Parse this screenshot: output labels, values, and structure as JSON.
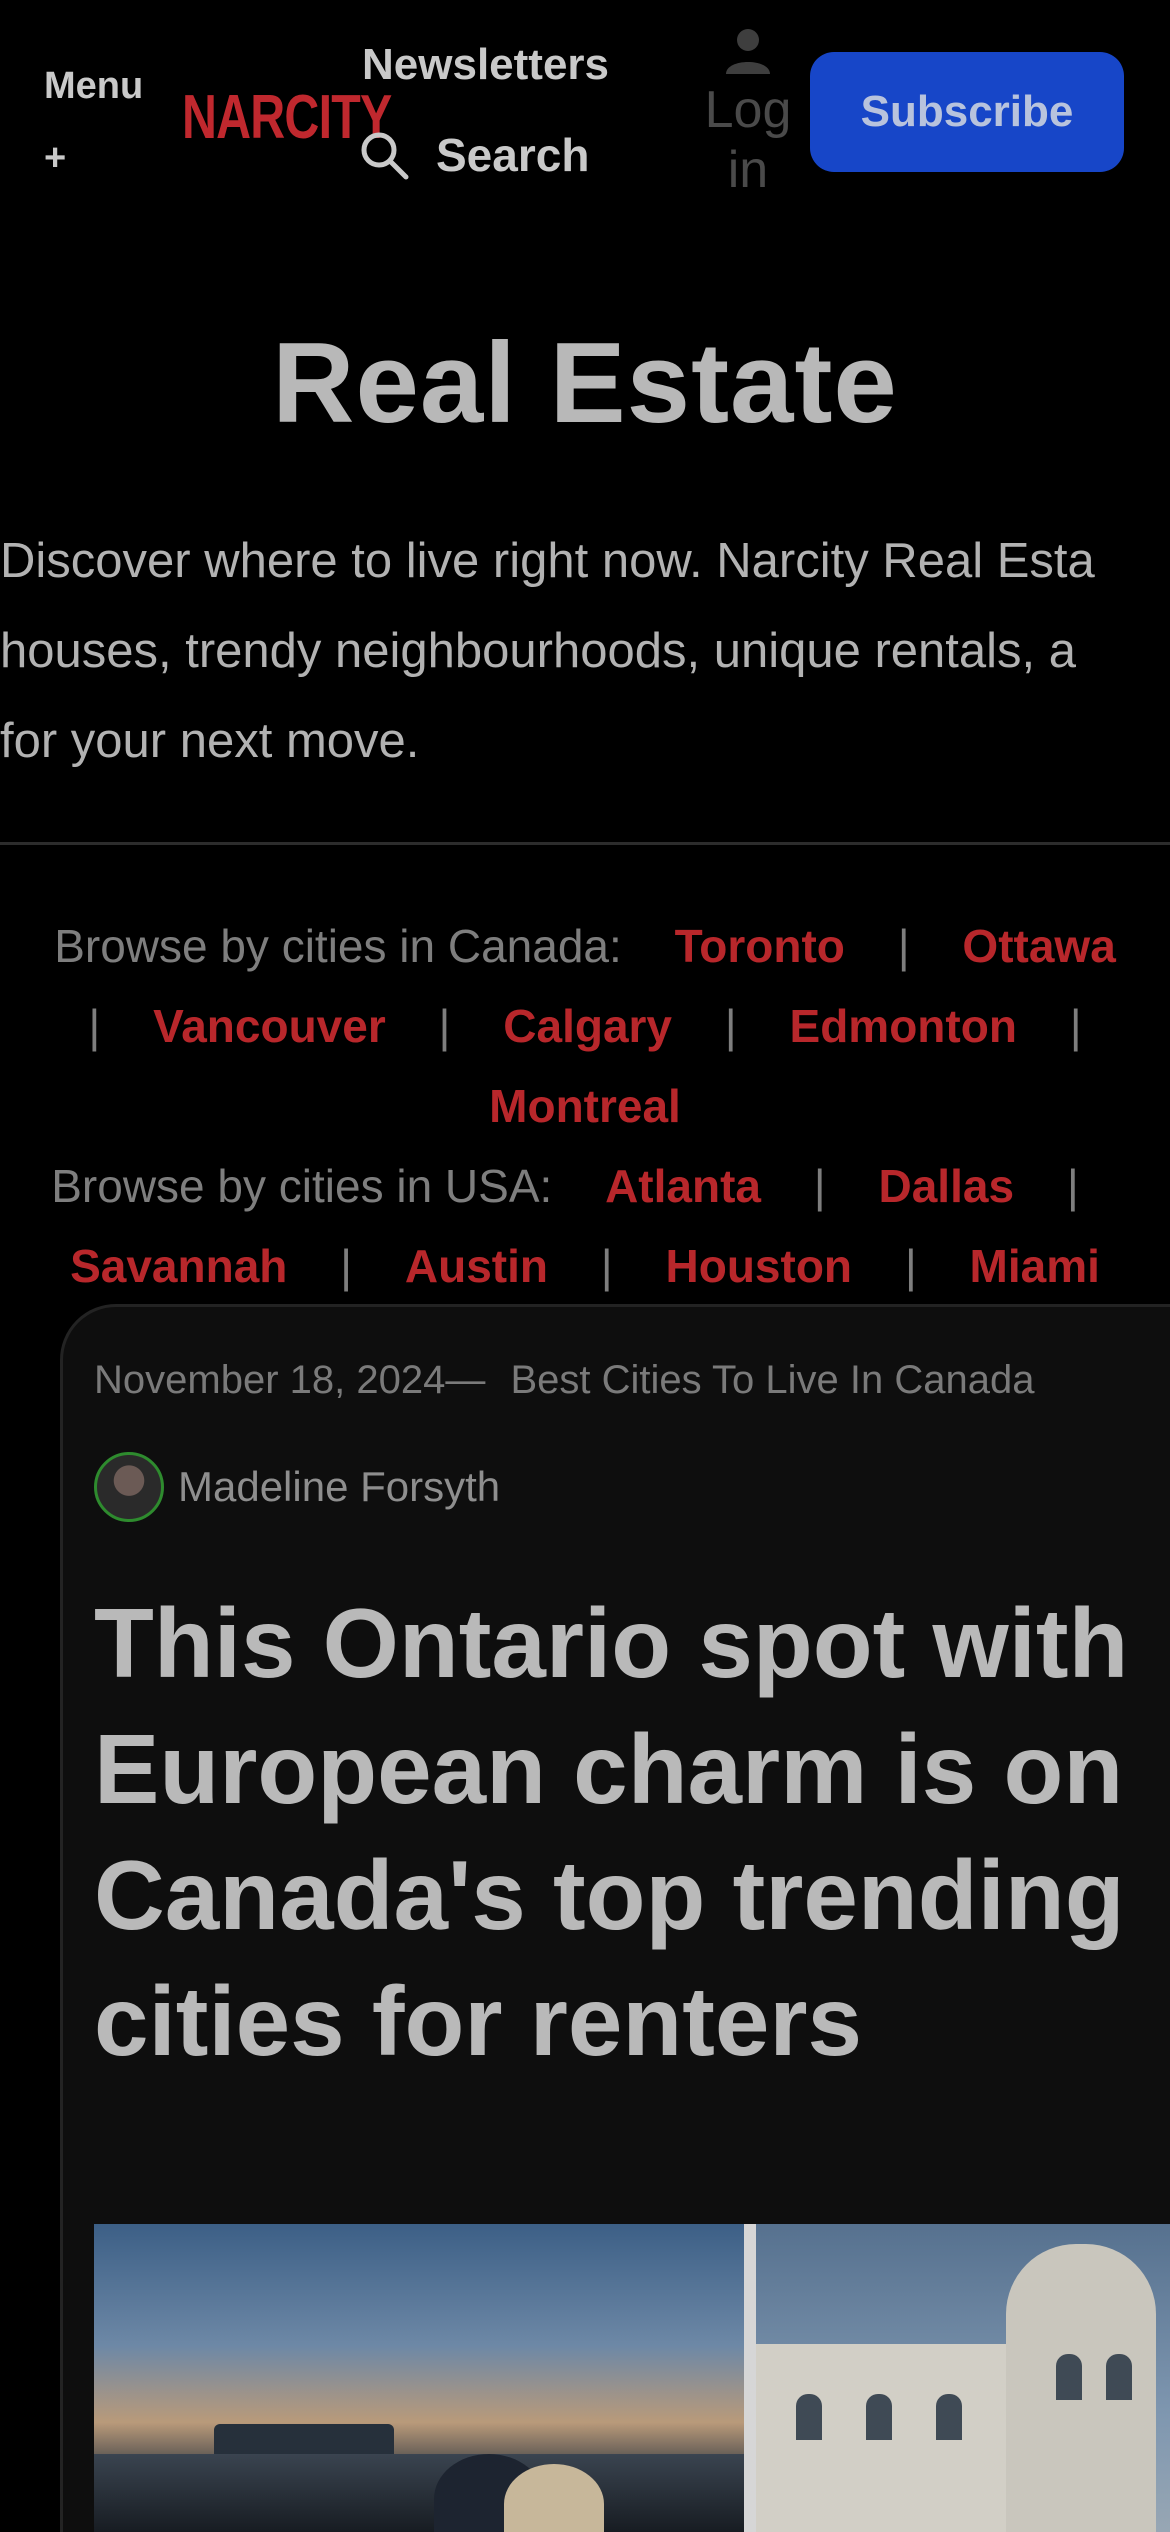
{
  "header": {
    "menu_label": "Menu",
    "menu_plus": "+",
    "logo_text": "NARCITY",
    "newsletters_label": "Newsletters",
    "search_label": "Search",
    "login_label": "Log in",
    "subscribe_label": "Subscribe"
  },
  "page": {
    "title": "Real Estate",
    "intro_lines": [
      "Discover where to live right now. Narcity Real Esta",
      "houses, trendy neighbourhoods, unique rentals, a",
      "for your next move."
    ]
  },
  "browse": {
    "canada_label": "Browse by cities in Canada:",
    "canada_cities": [
      "Toronto",
      "Ottawa",
      "Vancouver",
      "Calgary",
      "Edmonton",
      "Montreal"
    ],
    "usa_label": "Browse by cities in USA:",
    "usa_cities": [
      "Atlanta",
      "Dallas",
      "Savannah",
      "Austin",
      "Houston",
      "Miami"
    ],
    "separator": "|"
  },
  "article": {
    "date": "November 18, 2024",
    "dash": "—",
    "category": "Best Cities To Live In Canada",
    "author": "Madeline Forsyth",
    "headline_lines": [
      "This Ontario spot with",
      "European charm is on",
      "Canada's top trending",
      "cities for renters"
    ]
  },
  "colors": {
    "background": "#000000",
    "accent_red": "#b8272b",
    "subscribe_blue": "#1746c8",
    "card_bg": "#0e0e0e"
  },
  "icons": {
    "search": "search-icon",
    "user": "user-icon"
  }
}
